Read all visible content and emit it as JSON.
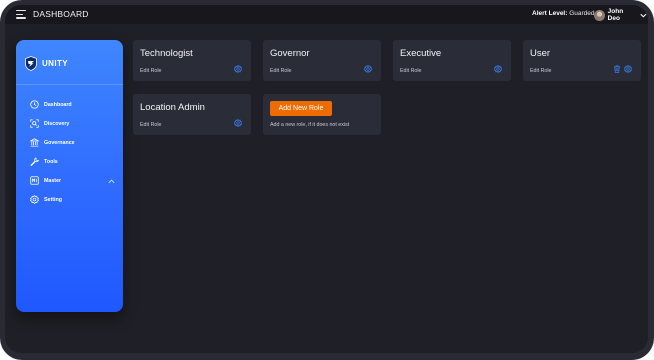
{
  "header": {
    "title": "DASHBOARD",
    "alert_label": "Alert Level:",
    "alert_value": "Guarded",
    "user_name": "John Deo"
  },
  "sidebar": {
    "brand": "UNITY",
    "items": [
      {
        "label": "Dashboard",
        "icon": "clock-icon"
      },
      {
        "label": "Discovery",
        "icon": "scan-icon"
      },
      {
        "label": "Governance",
        "icon": "bank-icon"
      },
      {
        "label": "Tools",
        "icon": "wrench-icon"
      },
      {
        "label": "Master",
        "icon": "master-icon"
      },
      {
        "label": "Setting",
        "icon": "gear-icon"
      }
    ]
  },
  "roles": [
    {
      "title": "Technologist",
      "action": "Edit Role"
    },
    {
      "title": "Governor",
      "action": "Edit Role"
    },
    {
      "title": "Executive",
      "action": "Edit Role"
    },
    {
      "title": "User",
      "action": "Edit Role"
    },
    {
      "title": "Location Admin",
      "action": "Edit Role"
    }
  ],
  "add_role": {
    "button_label": "Add New Role",
    "hint": "Add a new role, if it does not exist"
  },
  "colors": {
    "accent_blue": "#2f6bff",
    "button_orange": "#ef6c00",
    "card_bg": "#2a2c38",
    "page_bg": "#1f1f27"
  }
}
